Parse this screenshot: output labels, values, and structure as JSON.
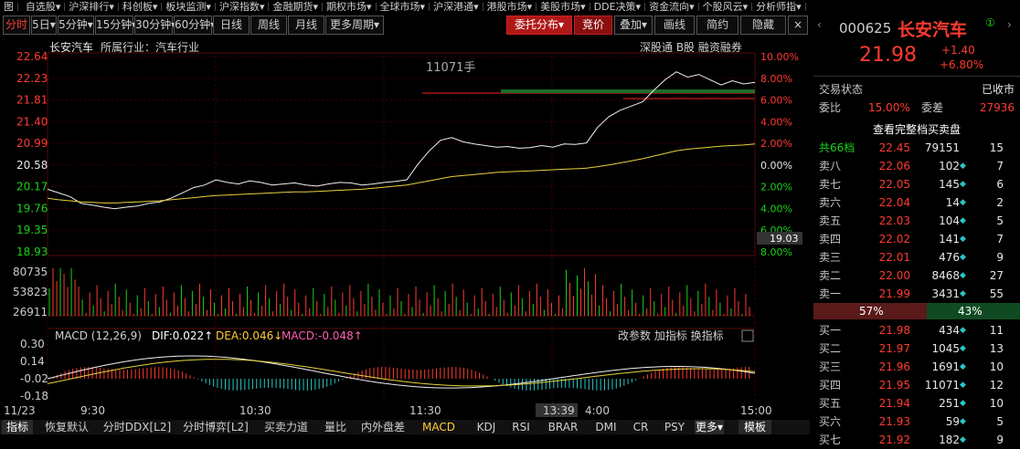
{
  "top_nav": [
    "自选股",
    "沪深排行",
    "科创板",
    "板块监测",
    "沪深指数",
    "金融期货",
    "期权市场",
    "全球市场",
    "沪深港通",
    "港股市场",
    "美股市场",
    "DDE决策",
    "资金流向",
    "个股风云",
    "分析师指"
  ],
  "top_nav_icon_label": "图",
  "toolbar": {
    "left": [
      "分时",
      "5日",
      "5分钟",
      "15分钟",
      "30分钟",
      "60分钟",
      "日线",
      "周线",
      "月线",
      "更多周期"
    ],
    "right": [
      "委托分布",
      "竞价",
      "叠加",
      "画线",
      "简约",
      "隐藏"
    ],
    "close": "×"
  },
  "chart_header": {
    "name": "长安汽车",
    "industry": "所属行业：汽车行业",
    "tags": [
      "深股通",
      "B股",
      "融资融券"
    ],
    "volume_note": "11071手"
  },
  "chart_data": {
    "type": "line",
    "price_axis": [
      "22.64",
      "22.23",
      "21.81",
      "21.40",
      "20.99",
      "20.58",
      "20.17",
      "19.76",
      "19.35",
      "18.93"
    ],
    "pct_axis": [
      "10.00%",
      "8.00%",
      "6.00%",
      "4.00%",
      "2.00%",
      "0.00%",
      "2.00%",
      "4.00%",
      "6.00%",
      "8.00%"
    ],
    "volume_axis": [
      "80735",
      "53823",
      "26911"
    ],
    "macd_axis": [
      "0.30",
      "0.14",
      "-0.02",
      "-0.18"
    ],
    "time_axis": [
      "11/23",
      "9:30",
      "10:30",
      "11:30",
      "13:39",
      "4:00",
      "15:00"
    ],
    "prev_close": 20.58,
    "price_points": [
      20.12,
      20.05,
      19.98,
      19.85,
      19.82,
      19.78,
      19.75,
      19.78,
      19.8,
      19.85,
      19.88,
      19.95,
      20.05,
      20.15,
      20.2,
      20.3,
      20.25,
      20.22,
      20.28,
      20.25,
      20.2,
      20.22,
      20.24,
      20.2,
      20.18,
      20.22,
      20.25,
      20.24,
      20.2,
      20.22,
      20.25,
      20.27,
      20.3,
      20.6,
      20.85,
      21.05,
      21.1,
      21.02,
      20.98,
      20.95,
      20.92,
      20.93,
      20.9,
      20.91,
      20.95,
      20.92,
      20.98,
      20.97,
      21.0,
      21.3,
      21.5,
      21.62,
      21.7,
      21.78,
      22.0,
      22.2,
      22.35,
      22.25,
      22.3,
      22.2,
      22.1,
      22.18,
      22.12,
      22.15
    ],
    "avg_points": [
      19.95,
      19.92,
      19.9,
      19.88,
      19.87,
      19.86,
      19.86,
      19.87,
      19.88,
      19.89,
      19.9,
      19.92,
      19.94,
      19.96,
      19.98,
      20.0,
      20.01,
      20.02,
      20.03,
      20.04,
      20.05,
      20.06,
      20.07,
      20.07,
      20.08,
      20.09,
      20.1,
      20.11,
      20.12,
      20.14,
      20.16,
      20.18,
      20.2,
      20.24,
      20.28,
      20.32,
      20.36,
      20.38,
      20.4,
      20.42,
      20.44,
      20.45,
      20.46,
      20.47,
      20.48,
      20.49,
      20.5,
      20.51,
      20.52,
      20.55,
      20.58,
      20.62,
      20.66,
      20.7,
      20.75,
      20.8,
      20.85,
      20.88,
      20.9,
      20.92,
      20.94,
      20.95,
      20.96,
      20.98
    ],
    "cursor_price": "19.03",
    "cursor_time": "13:39",
    "macd": {
      "label": "MACD (12,26,9)",
      "dif": "DIF:0.022↑",
      "dea": "DEA:0.046↓",
      "macd": "MACD:-0.048↑",
      "links": [
        "改参数",
        "加指标",
        "换指标"
      ]
    }
  },
  "bottom_tabs": [
    "指标",
    "恢复默认",
    "分时DDX[L2]",
    "分时博弈[L2]",
    "买卖力道",
    "量比",
    "内外盘差",
    "MACD",
    "KDJ",
    "RSI",
    "BRAR",
    "DMI",
    "CR",
    "PSY",
    "更多"
  ],
  "bottom_right": "模板",
  "quote": {
    "code": "000625",
    "name": "长安汽车",
    "badge": "①",
    "price": "21.98",
    "change": "+1.40",
    "change_pct": "+6.80%",
    "status_label": "交易状态",
    "status_value": "已收市",
    "ratio_label": "委比",
    "ratio_value": "15.00%",
    "diff_label": "委差",
    "diff_value": "27936",
    "full_book": "查看完整档买卖盘",
    "total_label": "共66档",
    "total_price": "22.45",
    "total_vol": "79151",
    "total_count": "15",
    "asks": [
      {
        "label": "卖八",
        "price": "22.06",
        "vol": "102",
        "count": "7"
      },
      {
        "label": "卖七",
        "price": "22.05",
        "vol": "145",
        "count": "6"
      },
      {
        "label": "卖六",
        "price": "22.04",
        "vol": "14",
        "count": "2"
      },
      {
        "label": "卖五",
        "price": "22.03",
        "vol": "104",
        "count": "5"
      },
      {
        "label": "卖四",
        "price": "22.02",
        "vol": "141",
        "count": "7"
      },
      {
        "label": "卖三",
        "price": "22.01",
        "vol": "476",
        "count": "9"
      },
      {
        "label": "卖二",
        "price": "22.00",
        "vol": "8468",
        "count": "27"
      },
      {
        "label": "卖一",
        "price": "21.99",
        "vol": "3431",
        "count": "55"
      }
    ],
    "buy_pct": "57%",
    "sell_pct": "43%",
    "bids": [
      {
        "label": "买一",
        "price": "21.98",
        "vol": "434",
        "count": "11"
      },
      {
        "label": "买二",
        "price": "21.97",
        "vol": "1045",
        "count": "13"
      },
      {
        "label": "买三",
        "price": "21.96",
        "vol": "1691",
        "count": "10"
      },
      {
        "label": "买四",
        "price": "21.95",
        "vol": "11071",
        "count": "12"
      },
      {
        "label": "买五",
        "price": "21.94",
        "vol": "251",
        "count": "10"
      },
      {
        "label": "买六",
        "price": "21.93",
        "vol": "59",
        "count": "5"
      },
      {
        "label": "买七",
        "price": "21.92",
        "vol": "182",
        "count": "9"
      }
    ]
  }
}
